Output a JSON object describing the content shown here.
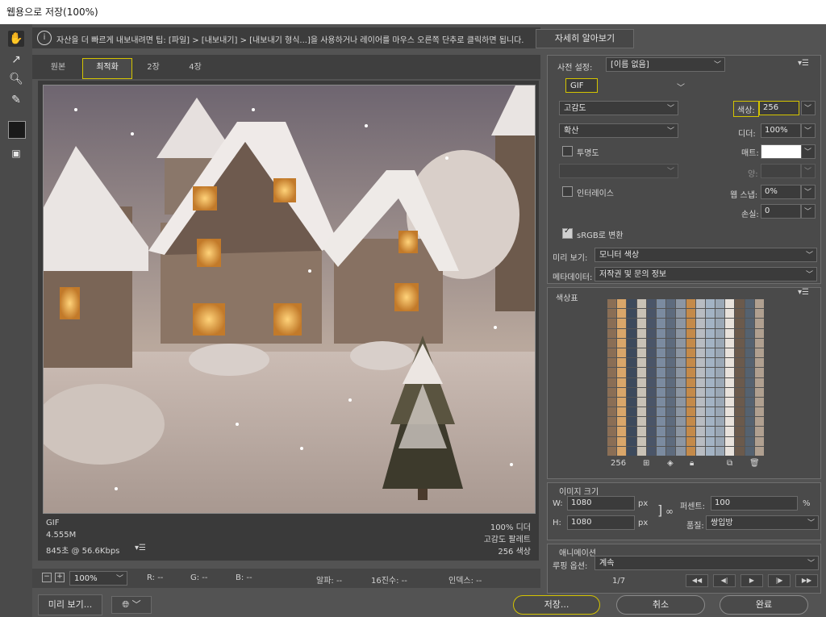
{
  "window": {
    "title": "웹용으로 저장(100%)"
  },
  "tools": {
    "hand": "hand-tool-icon",
    "slice": "slice-select-icon",
    "zoom": "zoom-icon",
    "eyedropper": "eyedropper-icon",
    "color": "#1a1a1a"
  },
  "info": {
    "text": "자산을 더 빠르게 내보내려면 팁: [파일] > [내보내기] > [내보내기 형식...]을 사용하거나 레이어를 마우스 오른쪽 단추로 클릭하면 됩니다.",
    "learn_more": "자세히 알아보기"
  },
  "tabs": [
    {
      "label": "원본",
      "selected": false
    },
    {
      "label": "최적화",
      "selected": true
    },
    {
      "label": "2장",
      "selected": false
    },
    {
      "label": "4장",
      "selected": false
    }
  ],
  "preview": {
    "format": "GIF",
    "size": "4.555M",
    "time": "845초 @ 56.6Kbps",
    "zoom_dither": "100% 디더",
    "palette": "고감도 팔레트",
    "colors": "256 색상"
  },
  "status": {
    "zoom": "100%",
    "r": "R: --",
    "g": "G: --",
    "b": "B: --",
    "alpha": "알파: --",
    "hex": "16진수: --",
    "index": "인덱스: --"
  },
  "bottom": {
    "preview": "미리 보기...",
    "save": "저장...",
    "cancel": "취소",
    "done": "완료"
  },
  "settings": {
    "preset_label": "사전 설정:",
    "preset_value": "[이름 없음]",
    "format": "GIF",
    "reduction": "고감도",
    "dither_algo": "확산",
    "transparency_label": "투명도",
    "interlace_label": "인터레이스",
    "colors_label": "색상:",
    "colors_value": "256",
    "dither_label": "디더:",
    "dither_value": "100%",
    "matte_label": "매트:",
    "amount_label": "양:",
    "websnap_label": "웹 스냅:",
    "websnap_value": "0%",
    "lossy_label": "손실:",
    "lossy_value": "0",
    "srgb_label": "sRGB로 변환",
    "preview_label": "미리 보기:",
    "preview_value": "모니터 색상",
    "metadata_label": "메타데이터:",
    "metadata_value": "저작권 및 문의 정보"
  },
  "color_table": {
    "title": "색상표",
    "count": "256"
  },
  "image_size": {
    "title": "이미지 크기",
    "w_label": "W:",
    "w_value": "1080",
    "h_label": "H:",
    "h_value": "1080",
    "unit": "px",
    "percent_label": "퍼센트:",
    "percent_value": "100",
    "percent_unit": "%",
    "quality_label": "품질:",
    "quality_value": "쌍입방"
  },
  "animation": {
    "title": "애니메이션",
    "loop_label": "루핑 옵션:",
    "loop_value": "계속",
    "frame": "1/7"
  }
}
